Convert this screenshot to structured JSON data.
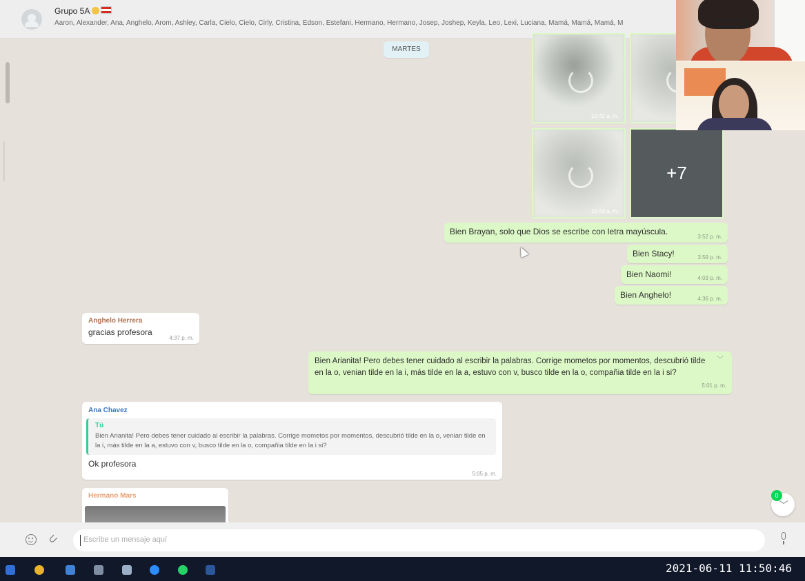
{
  "header": {
    "group_name": "Grupo 5A",
    "members": "Aaron, Alexander, Ana, Anghelo, Arom, Ashley, Carla, Cielo, Cielo, Cirly, Cristina, Edson, Estefani, Hermano, Hermano, Josep, Joshep, Keyla, Leo, Lexi, Luciana, Mamá, Mamá, Mamá, M"
  },
  "day_chip": "MARTES",
  "media": {
    "thumb1_time": "10:42 a. m.",
    "thumb3_time": "10:43 a. m.",
    "more_count": "+7"
  },
  "messages": {
    "out1": {
      "text": "Bien Brayan, solo que Dios se escribe con letra mayúscula.",
      "time": "3:52 p. m."
    },
    "out2": {
      "text": "Bien Stacy!",
      "time": "3:59 p. m."
    },
    "out3": {
      "text": "Bien Naomi!",
      "time": "4:03 p. m."
    },
    "out4": {
      "text": "Bien Anghelo!",
      "time": "4:36 p. m."
    },
    "in1": {
      "sender": "Anghelo Herrera",
      "text": "gracias profesora",
      "time": "4:37 p. m."
    },
    "out5": {
      "text": "Bien Arianita! Pero debes tener cuidado al escribir la palabras. Corrige mometos  por momentos, descubrió tilde en la o, venian tilde en la i, más tilde en la a, estuvo con v, busco tilde en la o, compañia tilde en la i si?",
      "time": "5:01 p. m."
    },
    "in2": {
      "sender": "Ana Chavez",
      "quote_author": "Tú",
      "quote_text": "Bien Arianita! Pero debes tener cuidado al escribir la palabras. Corrige mometos  por momentos, descubrió tilde en la o, venian tilde en la i, más tilde en la a, estuvo con v, busco tilde en la o, compañia tilde en la i si?",
      "text": "Ok profesora",
      "time": "5:05 p. m."
    },
    "in3": {
      "sender": "Hermano Mars"
    }
  },
  "unread_count": "0",
  "composer": {
    "placeholder": "Escribe un mensaje aquí"
  },
  "taskbar": {
    "clock": "2021-06-11 11:50:46"
  },
  "colors": {
    "chat_bg": "#e6e1db",
    "outgoing_bubble": "#dcf8c6",
    "incoming_bubble": "#ffffff",
    "sender_brown": "#b0714f",
    "sender_blue": "#3a76c4",
    "sender_orange": "#e9a073",
    "quote_green": "#35cd96",
    "taskbar": "#10182a"
  },
  "icons": {
    "composer_left": [
      "emoji-icon",
      "paperclip-icon"
    ],
    "composer_right": "microphone-icon",
    "scroll": "chevron-down-icon",
    "taskbar": [
      "windows-icon",
      "chrome-icon",
      "mail-icon",
      "calculator-icon",
      "pen-icon",
      "zoom-icon",
      "whatsapp-icon",
      "word-icon"
    ]
  }
}
